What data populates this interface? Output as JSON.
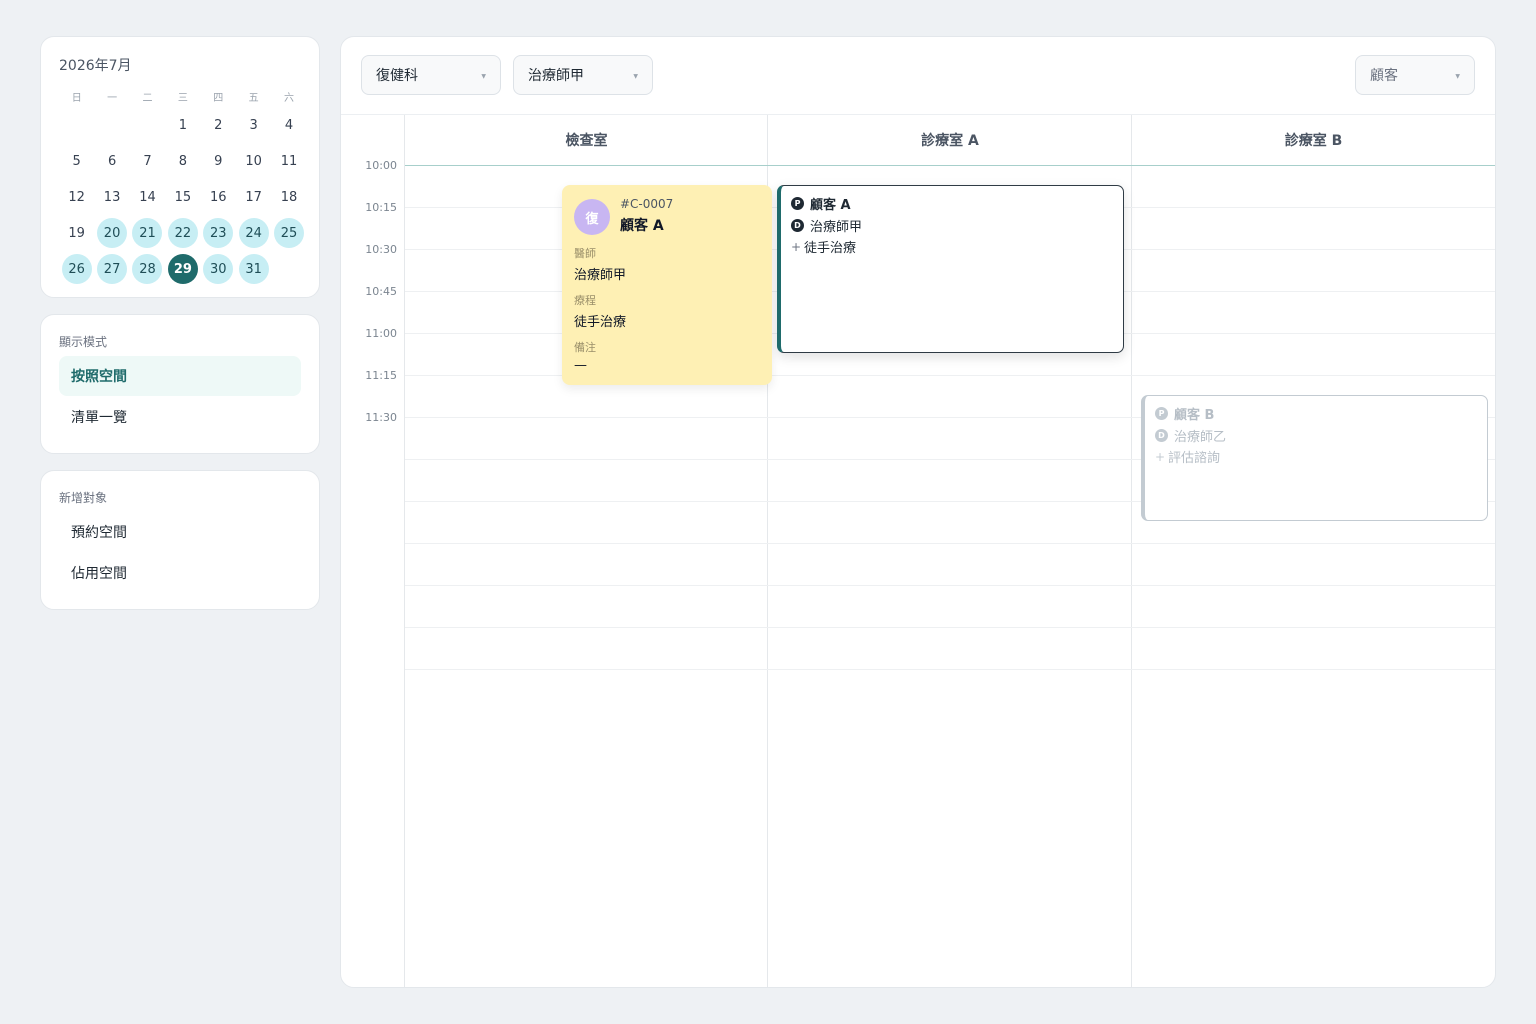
{
  "calendar": {
    "title": "2026年7月",
    "weekdays": [
      "日",
      "一",
      "二",
      "三",
      "四",
      "五",
      "六"
    ],
    "days": [
      [
        "",
        "",
        "",
        "1",
        "2",
        "3",
        "4"
      ],
      [
        "5",
        "6",
        "7",
        "8",
        "9",
        "10",
        "11"
      ],
      [
        "12",
        "13",
        "14",
        "15",
        "16",
        "17",
        "18"
      ],
      [
        "19",
        "20",
        "21",
        "22",
        "23",
        "24",
        "25"
      ],
      [
        "26",
        "27",
        "28",
        "29",
        "30",
        "31",
        ""
      ]
    ],
    "highlighted": [
      "20",
      "21",
      "22",
      "23",
      "24",
      "25",
      "26",
      "27",
      "28",
      "30",
      "31"
    ],
    "selected": "29"
  },
  "view_mode": {
    "title": "顯示模式",
    "items": [
      {
        "label": "按照空間",
        "active": true
      },
      {
        "label": "清單一覽",
        "active": false
      }
    ]
  },
  "add_panel": {
    "title": "新增對象",
    "items": [
      "預約空間",
      "佔用空間"
    ]
  },
  "toolbar": {
    "department": "復健科",
    "therapist": "治療師甲",
    "customer": "顧客"
  },
  "rooms": [
    "檢查室",
    "診療室 A",
    "診療室 B"
  ],
  "times": [
    "10:00",
    "10:15",
    "10:30",
    "10:45",
    "11:00",
    "11:15",
    "11:30"
  ],
  "popup": {
    "avatar": "復",
    "code": "#C-0007",
    "name": "顧客 A",
    "doctor_label": "醫師",
    "doctor": "治療師甲",
    "course_label": "療程",
    "course": "徒手治療",
    "note_label": "備注",
    "note": "—"
  },
  "appointments": [
    {
      "room": "診療室 A",
      "patient_badge": "P",
      "patient": "顧客 A",
      "doctor_badge": "D",
      "doctor": "治療師甲",
      "service": "徒手治療",
      "plus": "+"
    },
    {
      "room": "診療室 B",
      "patient_badge": "P",
      "patient": "顧客 B",
      "doctor_badge": "D",
      "doctor": "治療師乙",
      "service": "評估諮詢",
      "plus": "+"
    }
  ],
  "colors": {
    "accent": "#1f6b6b",
    "highlight_day": "#c7eef4",
    "popup_bg": "#fef0b4",
    "avatar": "#c8b6f2"
  }
}
